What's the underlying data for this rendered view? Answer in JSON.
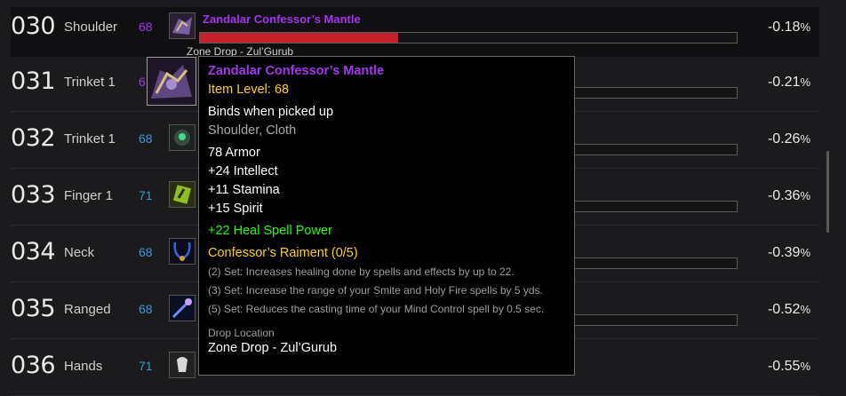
{
  "rows": [
    {
      "rank": "030",
      "slot": "Shoulder",
      "ilvl": "68",
      "pct": "-0.18",
      "unit": "%",
      "name": "Zandalar Confessor’s Mantle",
      "sub": "Zone Drop - Zul’Gurub",
      "fill": 0.37,
      "icon": "shoulder-icon"
    },
    {
      "rank": "031",
      "slot": "Trinket 1",
      "ilvl": "6",
      "pct": "-0.21",
      "unit": "%",
      "icon": "trinket-icon"
    },
    {
      "rank": "032",
      "slot": "Trinket 1",
      "ilvl": "68",
      "pct": "-0.26",
      "unit": "%",
      "icon": "trinket-icon"
    },
    {
      "rank": "033",
      "slot": "Finger 1",
      "ilvl": "71",
      "pct": "-0.36",
      "unit": "%",
      "icon": "ring-icon"
    },
    {
      "rank": "034",
      "slot": "Neck",
      "ilvl": "68",
      "pct": "-0.39",
      "unit": "%",
      "icon": "necklace-icon"
    },
    {
      "rank": "035",
      "slot": "Ranged",
      "ilvl": "68",
      "pct": "-0.52",
      "unit": "%",
      "icon": "wand-icon"
    },
    {
      "rank": "036",
      "slot": "Hands",
      "ilvl": "71",
      "pct": "-0.55",
      "unit": "%",
      "icon": "gloves-icon"
    }
  ],
  "tooltip": {
    "name": "Zandalar Confessor’s Mantle",
    "item_level": "Item Level: 68",
    "binds": "Binds when picked up",
    "type": "Shoulder, Cloth",
    "armor": "78 Armor",
    "stats": [
      "+24 Intellect",
      "+11 Stamina",
      "+15 Spirit"
    ],
    "bonus": "+22 Heal Spell Power",
    "set_name": "Confessor’s Raiment (0/5)",
    "set_bonuses": [
      "(2) Set: Increases healing done by spells and effects by up to 22.",
      "(3) Set: Increase the range of your Smite and Holy Fire spells by 5 yds.",
      "(5) Set: Reduces the casting time of your Mind Control spell by 0.5 sec."
    ],
    "drop_label": "Drop Location",
    "drop_value": "Zone Drop - Zul’Gurub"
  },
  "colors": {
    "epic": "#a335ee",
    "rare": "#3d98d6",
    "bar": "#c4212b",
    "gold": "#ffd100",
    "green": "#1eff00"
  }
}
